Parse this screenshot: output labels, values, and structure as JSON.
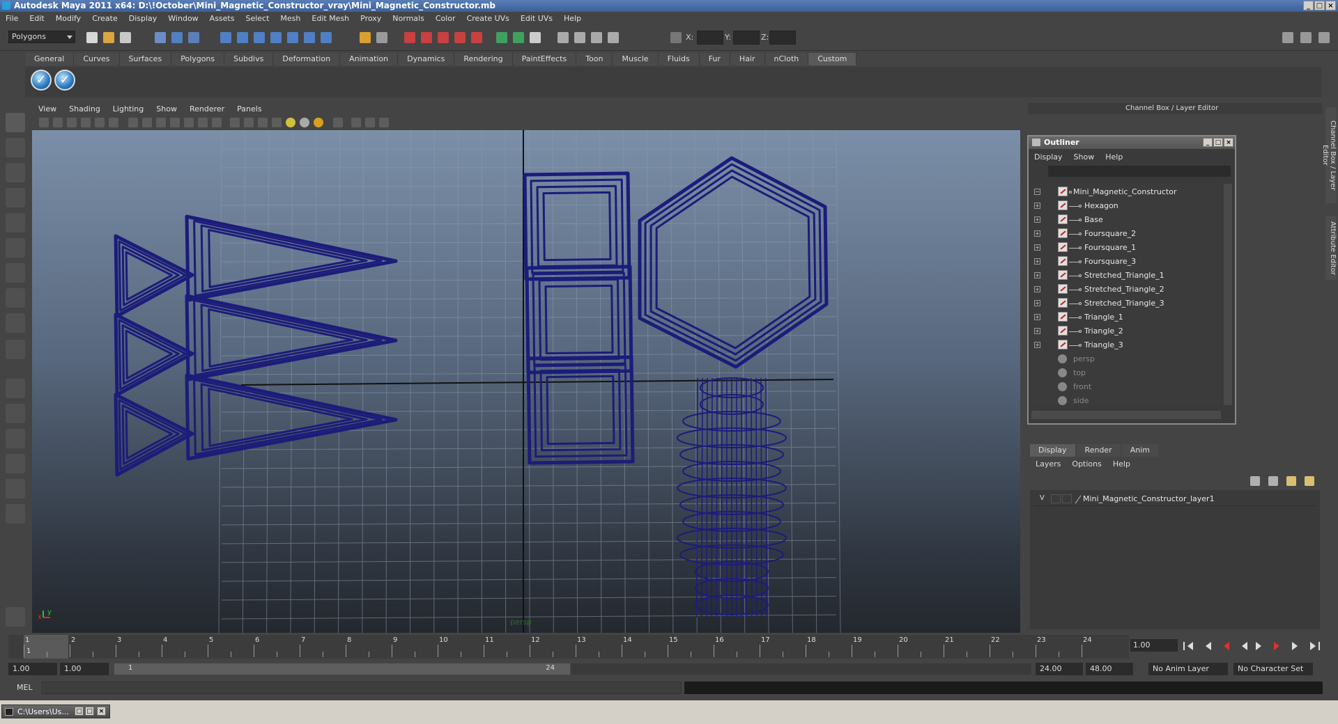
{
  "window": {
    "title": "Autodesk Maya 2011 x64: D:\\!October\\Mini_Magnetic_Constructor_vray\\Mini_Magnetic_Constructor.mb",
    "controls": [
      "_",
      "□",
      "×"
    ]
  },
  "menubar": [
    "File",
    "Edit",
    "Modify",
    "Create",
    "Display",
    "Window",
    "Assets",
    "Select",
    "Mesh",
    "Edit Mesh",
    "Proxy",
    "Normals",
    "Color",
    "Create UVs",
    "Edit UVs",
    "Help"
  ],
  "statusline": {
    "mode": "Polygons",
    "x_label": "X:",
    "y_label": "Y:",
    "z_label": "Z:"
  },
  "shelf": {
    "tabs": [
      "General",
      "Curves",
      "Surfaces",
      "Polygons",
      "Subdivs",
      "Deformation",
      "Animation",
      "Dynamics",
      "Rendering",
      "PaintEffects",
      "Toon",
      "Muscle",
      "Fluids",
      "Fur",
      "Hair",
      "nCloth",
      "Custom"
    ],
    "active_tab": "Custom"
  },
  "viewport": {
    "menu": [
      "View",
      "Shading",
      "Lighting",
      "Show",
      "Renderer",
      "Panels"
    ],
    "camera_label": "persp",
    "wire_color": "#1c1c7a"
  },
  "channel_box": {
    "header": "Channel Box / Layer Editor",
    "side_tabs": [
      "Channel Box / Layer Editor",
      "Attribute Editor"
    ]
  },
  "outliner": {
    "title": "Outliner",
    "controls": [
      "_",
      "□",
      "×"
    ],
    "menu": [
      "Display",
      "Show",
      "Help"
    ],
    "items": [
      {
        "label": "Mini_Magnetic_Constructor",
        "type": "mesh",
        "depth": 0,
        "expander": "−"
      },
      {
        "label": "Hexagon",
        "type": "mesh",
        "depth": 1,
        "expander": "+"
      },
      {
        "label": "Base",
        "type": "mesh",
        "depth": 1,
        "expander": "+"
      },
      {
        "label": "Foursquare_2",
        "type": "mesh",
        "depth": 1,
        "expander": "+"
      },
      {
        "label": "Foursquare_1",
        "type": "mesh",
        "depth": 1,
        "expander": "+"
      },
      {
        "label": "Foursquare_3",
        "type": "mesh",
        "depth": 1,
        "expander": "+"
      },
      {
        "label": "Stretched_Triangle_1",
        "type": "mesh",
        "depth": 1,
        "expander": "+"
      },
      {
        "label": "Stretched_Triangle_2",
        "type": "mesh",
        "depth": 1,
        "expander": "+"
      },
      {
        "label": "Stretched_Triangle_3",
        "type": "mesh",
        "depth": 1,
        "expander": "+"
      },
      {
        "label": "Triangle_1",
        "type": "mesh",
        "depth": 1,
        "expander": "+"
      },
      {
        "label": "Triangle_2",
        "type": "mesh",
        "depth": 1,
        "expander": "+"
      },
      {
        "label": "Triangle_3",
        "type": "mesh",
        "depth": 1,
        "expander": "+"
      },
      {
        "label": "persp",
        "type": "camera",
        "depth": 0,
        "expander": ""
      },
      {
        "label": "top",
        "type": "camera",
        "depth": 0,
        "expander": ""
      },
      {
        "label": "front",
        "type": "camera",
        "depth": 0,
        "expander": ""
      },
      {
        "label": "side",
        "type": "camera",
        "depth": 0,
        "expander": ""
      }
    ]
  },
  "layer_editor": {
    "tabs": [
      "Display",
      "Render",
      "Anim"
    ],
    "active_tab": "Display",
    "menu": [
      "Layers",
      "Options",
      "Help"
    ],
    "layers": [
      {
        "visible": "V",
        "name": "Mini_Magnetic_Constructor_layer1"
      }
    ]
  },
  "timeline": {
    "frames": [
      "1",
      "2",
      "3",
      "4",
      "5",
      "6",
      "7",
      "8",
      "9",
      "10",
      "11",
      "12",
      "13",
      "14",
      "15",
      "16",
      "17",
      "18",
      "19",
      "20",
      "21",
      "22",
      "23",
      "24"
    ],
    "current_frame_marker": "1",
    "current_frame": "1.00"
  },
  "range": {
    "start": "1.00",
    "playback_start": "1.00",
    "bar_start": "1",
    "bar_end": "24",
    "playback_end": "24.00",
    "end": "48.00",
    "anim_layer": "No Anim Layer",
    "character_set": "No Character Set"
  },
  "command_line": {
    "label": "MEL"
  },
  "taskbar": {
    "task": "C:\\Users\\Us...",
    "controls": [
      "□",
      "□",
      "×"
    ]
  }
}
